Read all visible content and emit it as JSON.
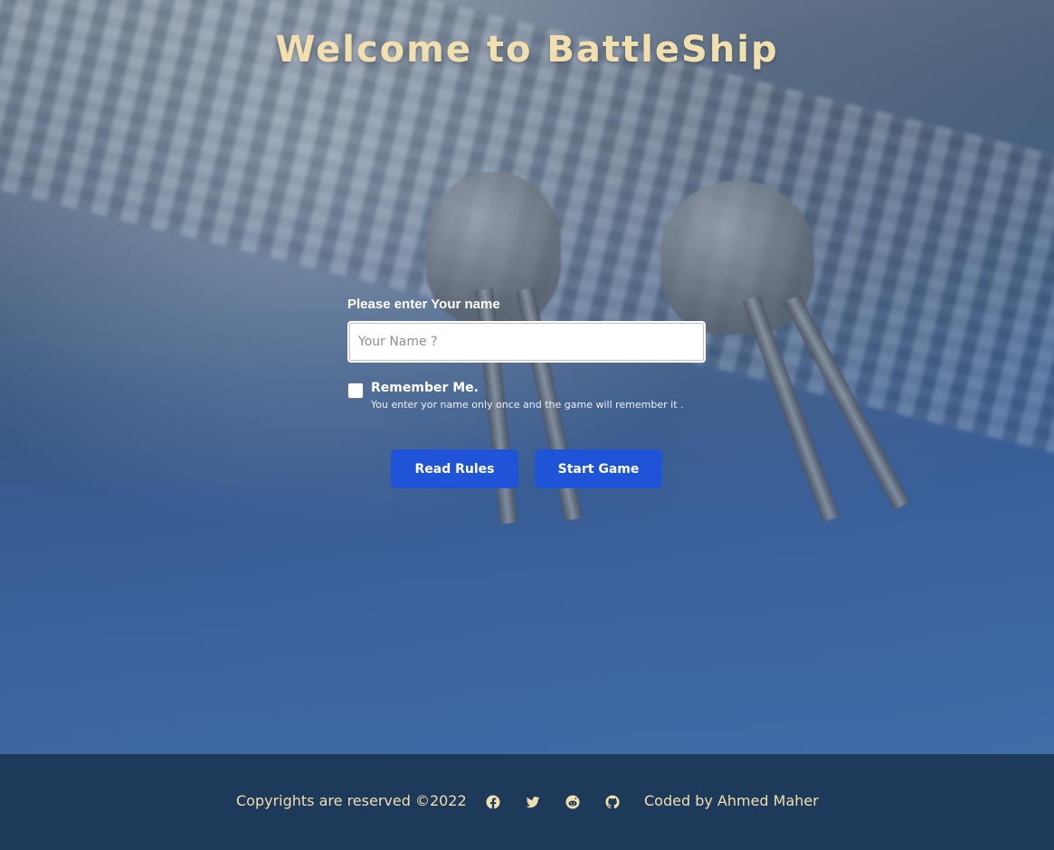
{
  "page_title": "Welcome to BattleShip",
  "form": {
    "name_label": "Please enter Your name",
    "name_placeholder": "Your Name ?",
    "remember_label": "Remember Me.",
    "remember_hint": "You enter yor name only once and the game will remember it ."
  },
  "buttons": {
    "rules_label": "Read Rules",
    "start_label": "Start Game"
  },
  "footer": {
    "copyright": "Copyrights are reserved ©2022",
    "credit": "Coded by Ahmed Maher",
    "social_icons": [
      "facebook-icon",
      "twitter-icon",
      "reddit-icon",
      "github-icon"
    ]
  },
  "colors": {
    "accent": "#1f54d8",
    "title_gold": "#f2dfae",
    "footer_bg": "#1e3a5a"
  }
}
